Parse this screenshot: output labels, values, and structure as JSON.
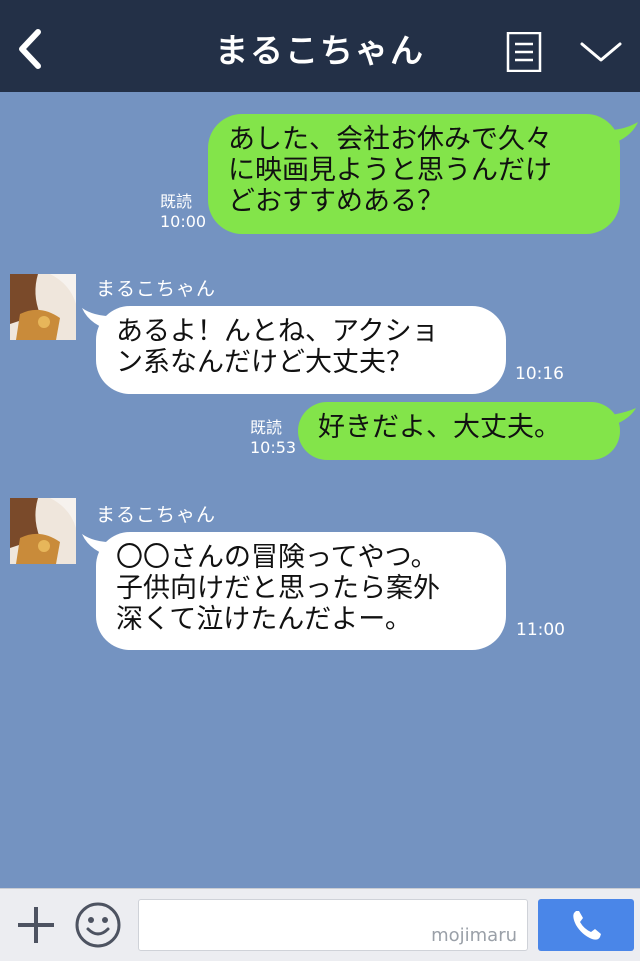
{
  "header": {
    "title": "まるこちゃん",
    "back_icon": "chevron-left-icon",
    "menu_icon": "document-menu-icon",
    "dropdown_icon": "chevron-down-icon"
  },
  "messages": [
    {
      "direction": "outgoing",
      "text": "あした、会社お休みで久々\nに映画見ようと思うんだけ\nどおすすめある？",
      "read_label": "既読",
      "time": "10:00"
    },
    {
      "direction": "incoming",
      "sender": "まるこちゃん",
      "text": "あるよ！んとね、アクショ\nン系なんだけど大丈夫？",
      "time": "10:16"
    },
    {
      "direction": "outgoing",
      "text": "好きだよ、大丈夫。",
      "read_label": "既読",
      "time": "10:53"
    },
    {
      "direction": "incoming",
      "sender": "まるこちゃん",
      "text": "〇〇さんの冒険ってやつ。\n子供向けだと思ったら案外\n深くて泣けたんだよー。",
      "time": "11:00"
    }
  ],
  "composer": {
    "watermark": "mojimaru",
    "plus_icon": "plus-icon",
    "emoji_icon": "smiley-icon",
    "call_icon": "phone-icon"
  },
  "colors": {
    "header_bg": "#233047",
    "chat_bg": "#7493c1",
    "outgoing_bubble": "#83e44a",
    "incoming_bubble": "#ffffff",
    "call_button": "#4a86e8"
  }
}
